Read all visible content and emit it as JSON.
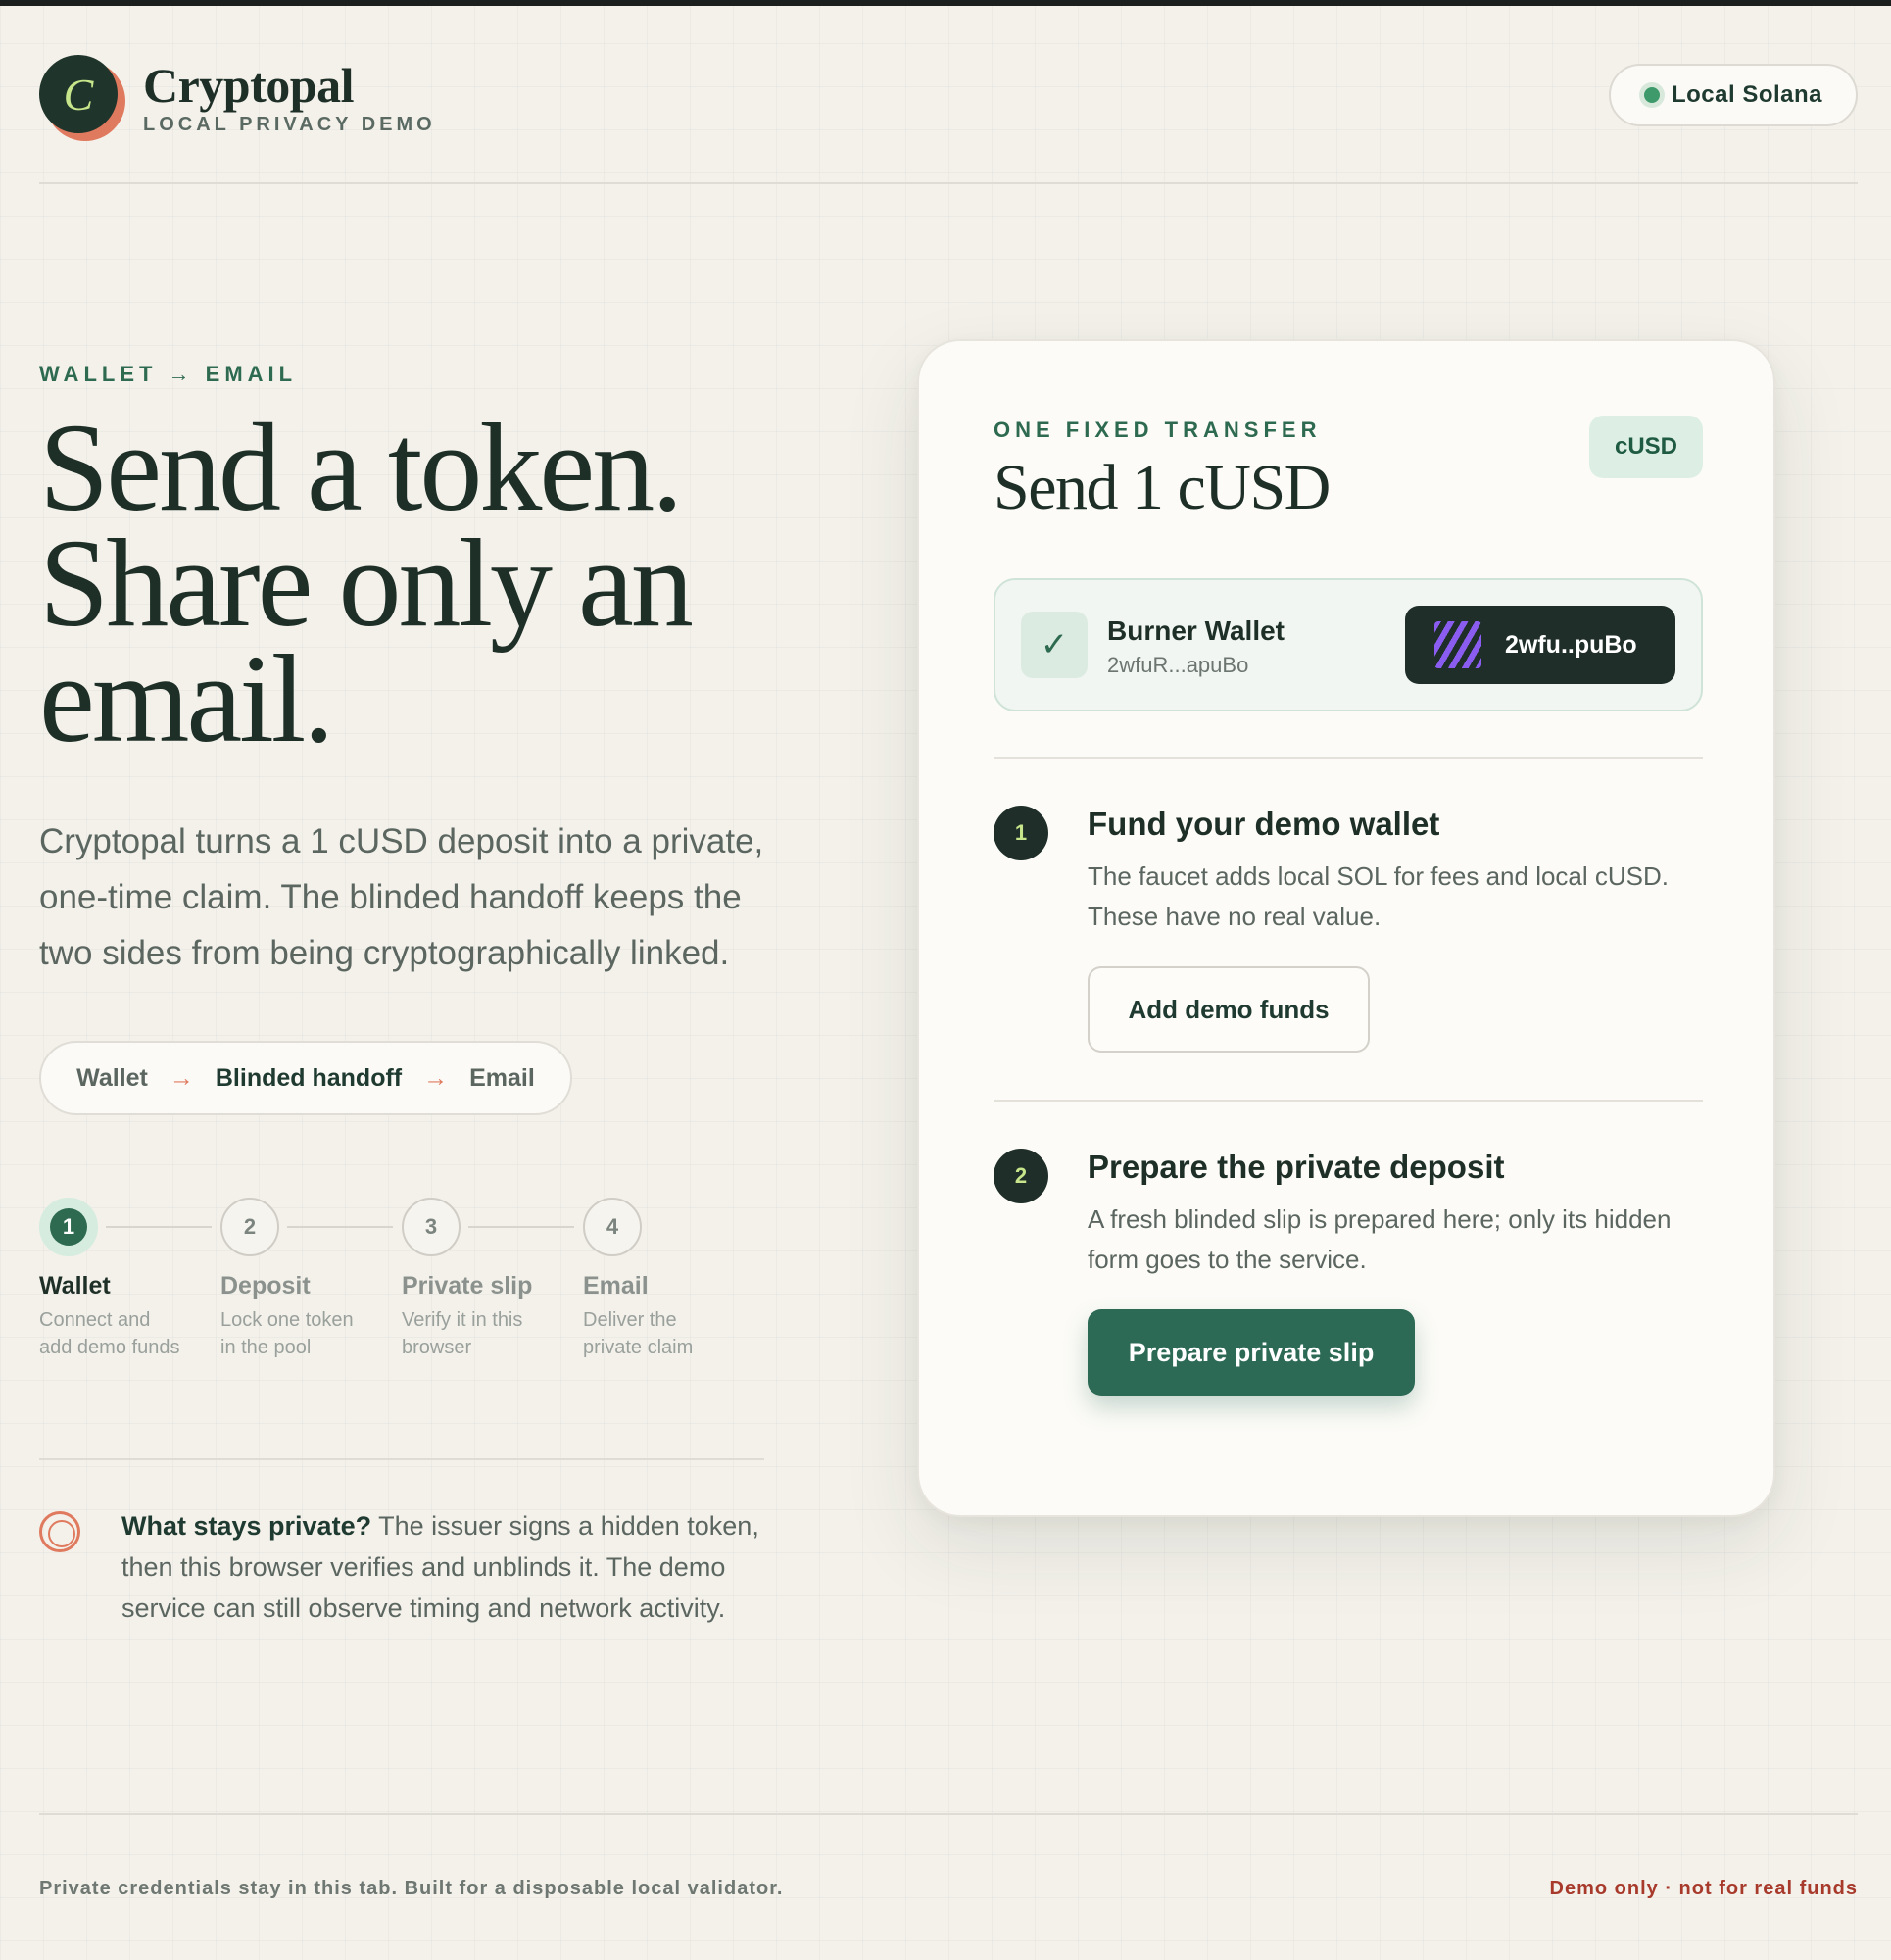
{
  "brand": {
    "logo_letter": "C",
    "name": "Cryptopal",
    "subtitle": "LOCAL PRIVACY DEMO"
  },
  "network": {
    "label": "Local Solana",
    "status_color": "#3e9a6a"
  },
  "hero": {
    "kicker": "WALLET → EMAIL",
    "title_line1": "Send a token.",
    "title_line2": "Share only an",
    "title_line3": "email.",
    "description": "Cryptopal turns a 1 cUSD deposit into a private, one-time claim. The blinded handoff keeps the two sides from being cryptographically linked."
  },
  "flow": {
    "from": "Wallet",
    "middle": "Blinded handoff",
    "to": "Email",
    "arrow": "→"
  },
  "steps": [
    {
      "number": "1",
      "title": "Wallet",
      "desc_line1": "Connect and",
      "desc_line2": "add demo funds",
      "active": true
    },
    {
      "number": "2",
      "title": "Deposit",
      "desc_line1": "Lock one token",
      "desc_line2": "in the pool",
      "active": false
    },
    {
      "number": "3",
      "title": "Private slip",
      "desc_line1": "Verify it in this",
      "desc_line2": "browser",
      "active": false
    },
    {
      "number": "4",
      "title": "Email",
      "desc_line1": "Deliver the",
      "desc_line2": "private claim",
      "active": false
    }
  ],
  "privacy": {
    "question": "What stays private?",
    "answer": " The issuer signs a hidden token, then this browser verifies and unblinds it. The demo service can still observe timing and network activity."
  },
  "card": {
    "kicker": "ONE FIXED TRANSFER",
    "title": "Send 1 cUSD",
    "token_badge": "cUSD",
    "wallet": {
      "check": "✓",
      "name": "Burner Wallet",
      "address": "2wfuR...apuBo",
      "button_label": "2wfu..puBo"
    },
    "step1": {
      "number": "1",
      "title": "Fund your demo wallet",
      "description": "The faucet adds local SOL for fees and local cUSD. These have no real value.",
      "button": "Add demo funds"
    },
    "step2": {
      "number": "2",
      "title": "Prepare the private deposit",
      "description": "A fresh blinded slip is prepared here; only its hidden form goes to the service.",
      "button": "Prepare private slip"
    }
  },
  "footer": {
    "left": "Private credentials stay in this tab. Built for a disposable local validator.",
    "right": "Demo only · not for real funds"
  },
  "colors": {
    "accent": "#2d6a4f",
    "accent_warm": "#e07a5f",
    "warning": "#a83a2c",
    "ink": "#1e2f28"
  }
}
